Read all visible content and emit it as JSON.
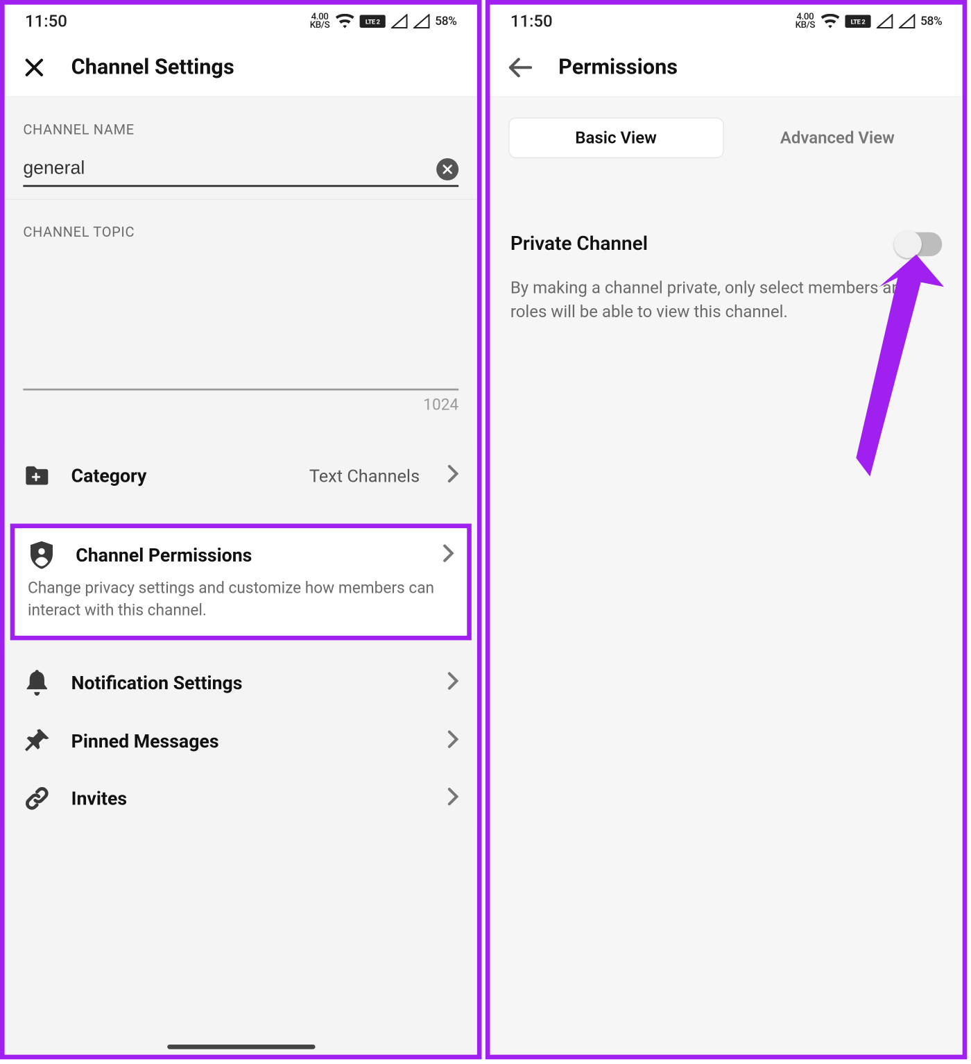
{
  "status": {
    "time": "11:50",
    "kbs_top": "4.00",
    "kbs_bot": "KB/S",
    "battery": "58%"
  },
  "left": {
    "header_title": "Channel Settings",
    "channel_name_label": "CHANNEL NAME",
    "channel_name_value": "general",
    "channel_topic_label": "CHANNEL TOPIC",
    "char_count": "1024",
    "category": {
      "label": "Category",
      "value": "Text Channels"
    },
    "permissions": {
      "label": "Channel Permissions",
      "desc": "Change privacy settings and customize how members can interact with this channel."
    },
    "notifications": {
      "label": "Notification Settings"
    },
    "pinned": {
      "label": "Pinned Messages"
    },
    "invites": {
      "label": "Invites"
    }
  },
  "right": {
    "header_title": "Permissions",
    "tabs": {
      "basic": "Basic View",
      "advanced": "Advanced View"
    },
    "private_channel_label": "Private Channel",
    "private_channel_desc": "By making a channel private, only select members and roles will be able to view this channel."
  }
}
